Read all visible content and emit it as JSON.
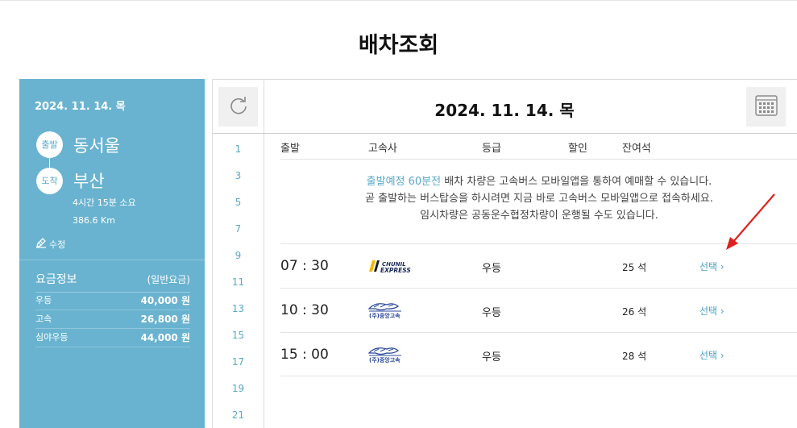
{
  "page": {
    "title": "배차조회"
  },
  "info": {
    "date": "2024. 11. 14. 목",
    "departure_label": "출발",
    "departure_city": "동서울",
    "arrival_label": "도착",
    "arrival_city": "부산",
    "duration": "4시간 15분 소요",
    "distance": "386.6 Km",
    "edit_label": "수정"
  },
  "fares": {
    "title": "요금정보",
    "type": "(일반요금)",
    "rows": [
      {
        "label": "우등",
        "value": "40,000 원"
      },
      {
        "label": "고속",
        "value": "26,800 원"
      },
      {
        "label": "심야우등",
        "value": "44,000 원"
      }
    ]
  },
  "header": {
    "date": "2024. 11. 14. 목"
  },
  "hours": [
    "1",
    "3",
    "5",
    "7",
    "9",
    "11",
    "13",
    "15",
    "17",
    "19",
    "21"
  ],
  "columns": {
    "departure": "출발",
    "company": "고속사",
    "grade": "등급",
    "discount": "할인",
    "seats": "잔여석"
  },
  "notice": {
    "highlight": "출발예정 60분전",
    "line1_rest": " 배차 차량은 고속버스 모바일앱을 통하여 예매할 수 있습니다.",
    "line2": "곧 출발하는 버스탑승을 하시려면 지금 바로 고속버스 모바일앱으로 접속하세요.",
    "line3": "임시차량은 공동운수협정차량이 운행될 수도 있습니다."
  },
  "buses": [
    {
      "time": "07 : 30",
      "company_logo_text_1": "CHUNIL",
      "company_logo_text_2": "EXPRESS",
      "grade": "우등",
      "seats": "25 석",
      "select": "선택"
    },
    {
      "time": "10 : 30",
      "company_logo_text": "(주)중앙고속",
      "grade": "우등",
      "seats": "26 석",
      "select": "선택"
    },
    {
      "time": "15 : 00",
      "company_logo_text": "(주)중앙고속",
      "grade": "우등",
      "seats": "28 석",
      "select": "선택"
    }
  ],
  "icons": {
    "refresh": "refresh-icon",
    "calendar": "calendar-icon",
    "edit": "edit-icon",
    "chevron": "chevron-right-icon",
    "annotation_arrow": "red-arrow"
  },
  "colors": {
    "panel": "#69b3d0",
    "accent": "#5aa8c7",
    "annotation": "#e02020"
  }
}
